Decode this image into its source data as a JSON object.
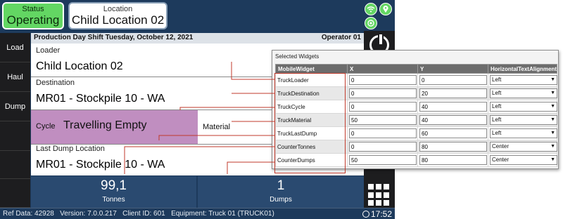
{
  "header": {
    "status_label": "Status",
    "status_value": "Operating",
    "location_label": "Location",
    "location_value": "Child Location 02",
    "icons": [
      "wifi-icon",
      "location-pin-icon",
      "gps-icon"
    ]
  },
  "nav": [
    {
      "label": "Load"
    },
    {
      "label": "Haul"
    },
    {
      "label": "Dump"
    }
  ],
  "infobar": {
    "shift_text": "Production Day Shift Tuesday, October 12, 2021",
    "operator": "Operator 01"
  },
  "fields": {
    "loader_label": "Loader",
    "loader_value": "Child Location 02",
    "destination_label": "Destination",
    "destination_value": "MR01 - Stockpile 10 - WA",
    "cycle_label": "Cycle",
    "cycle_value": "Travelling Empty",
    "material_label": "Material",
    "last_dump_label": "Last Dump Location",
    "last_dump_value": "MR01 - Stockpile 10 - WA"
  },
  "stats": [
    {
      "value": "99,1",
      "label": "Tonnes"
    },
    {
      "value": "1",
      "label": "Dumps"
    }
  ],
  "footer": {
    "ref_data": "Ref Data: 42928",
    "version": "Version: 7.0.0.217",
    "client_id": "Client ID: 601",
    "equipment": "Equipment: Truck 01 (TRUCK01)",
    "time": "17:52"
  },
  "widgets": {
    "title": "Selected Widgets",
    "columns": [
      "MobileWidget",
      "X",
      "Y",
      "HorizontalTextAlignment"
    ],
    "rows": [
      {
        "widget": "TruckLoader",
        "x": "0",
        "y": "0",
        "align": "Left"
      },
      {
        "widget": "TruckDestination",
        "x": "0",
        "y": "20",
        "align": "Left"
      },
      {
        "widget": "TruckCycle",
        "x": "0",
        "y": "40",
        "align": "Left"
      },
      {
        "widget": "TruckMaterial",
        "x": "50",
        "y": "40",
        "align": "Left"
      },
      {
        "widget": "TruckLastDump",
        "x": "0",
        "y": "60",
        "align": "Left"
      },
      {
        "widget": "CounterTonnes",
        "x": "0",
        "y": "80",
        "align": "Center"
      },
      {
        "widget": "CounterDumps",
        "x": "50",
        "y": "80",
        "align": "Center"
      }
    ]
  },
  "colors": {
    "status_green": "#63d663",
    "app_blue": "#1d3a5c",
    "cycle_purple": "#c08ec0",
    "connector_red": "#c0392b"
  }
}
